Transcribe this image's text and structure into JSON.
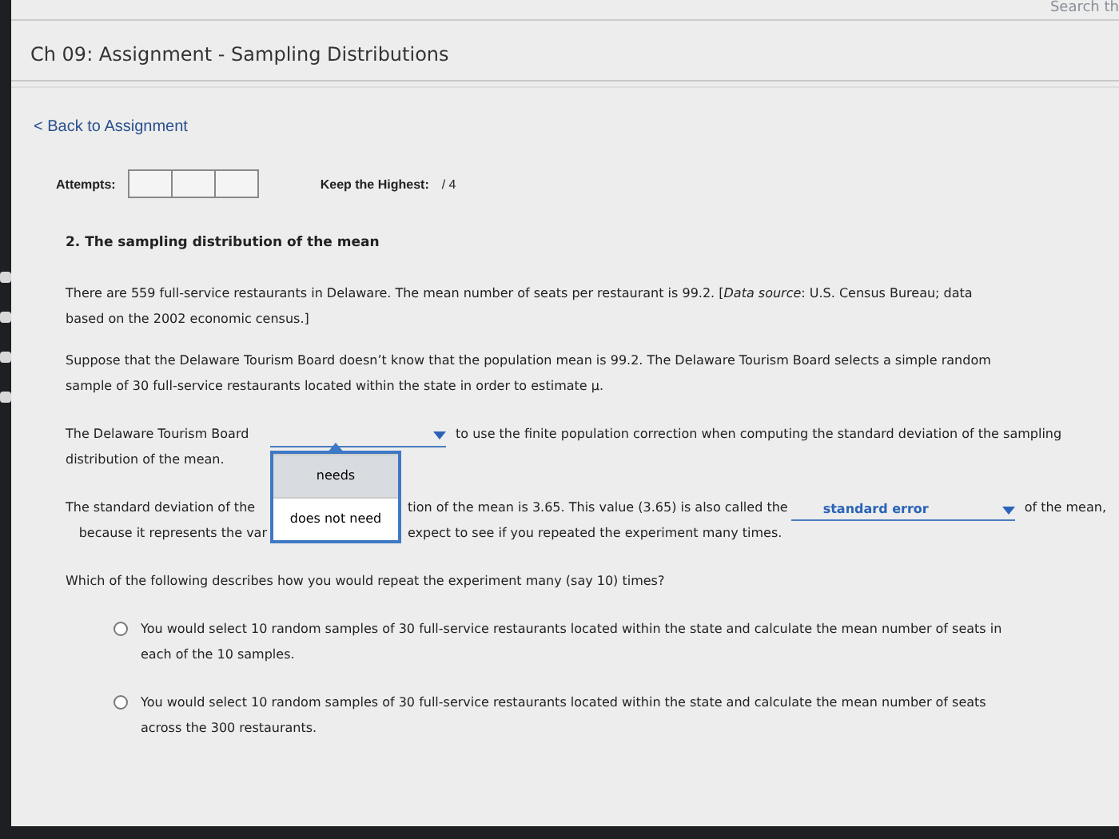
{
  "header": {
    "search_text": "Search th",
    "title": "Ch 09: Assignment - Sampling Distributions"
  },
  "back_link": "< Back to Assignment",
  "attempts": {
    "label": "Attempts:",
    "keep_label": "Keep the Highest:",
    "keep_value": "/ 4"
  },
  "question": {
    "title": "2. The sampling distribution of the mean",
    "paragraphs": [
      "There are 559 full-service restaurants in Delaware. The mean number of seats per restaurant is 99.2. [*Data source*: U.S. Census Bureau; data based on the 2002 economic census.]",
      "Suppose that the Delaware Tourism Board doesn’t know that the population mean is 99.2. The Delaware Tourism Board selects a simple random sample of 30 full-service restaurants located within the state in order to estimate μ."
    ],
    "blank_1": {
      "before": "The Delaware Tourism Board",
      "after": "to use the finite population correction when computing the standard deviation of the sampling",
      "continuation": "distribution of the mean.",
      "open": true,
      "options": [
        {
          "label": "needs",
          "selected": true
        },
        {
          "label": "does not need",
          "selected": false
        }
      ]
    },
    "sentence_2": {
      "line_1_start": "The standard deviation of the",
      "line_1_rest": "tion of the mean is 3.65. This value (3.65) is also called the",
      "blank_value": "standard error",
      "line_1_end": "of the mean,",
      "line_2_start": "because it represents the var",
      "line_2_rest": "expect to see if you repeated the experiment many times."
    },
    "prompt": "Which of the following describes how you would repeat the experiment many (say 10) times?",
    "choices": [
      {
        "text": "You would select 10 random samples of 30 full-service restaurants located within the state and calculate the mean number of seats in each of the 10 samples.",
        "selected": false
      },
      {
        "text": "You would select 10 random samples of 30 full-service restaurants located within the state and calculate the mean number of seats across the 300 restaurants.",
        "selected": false
      }
    ]
  }
}
